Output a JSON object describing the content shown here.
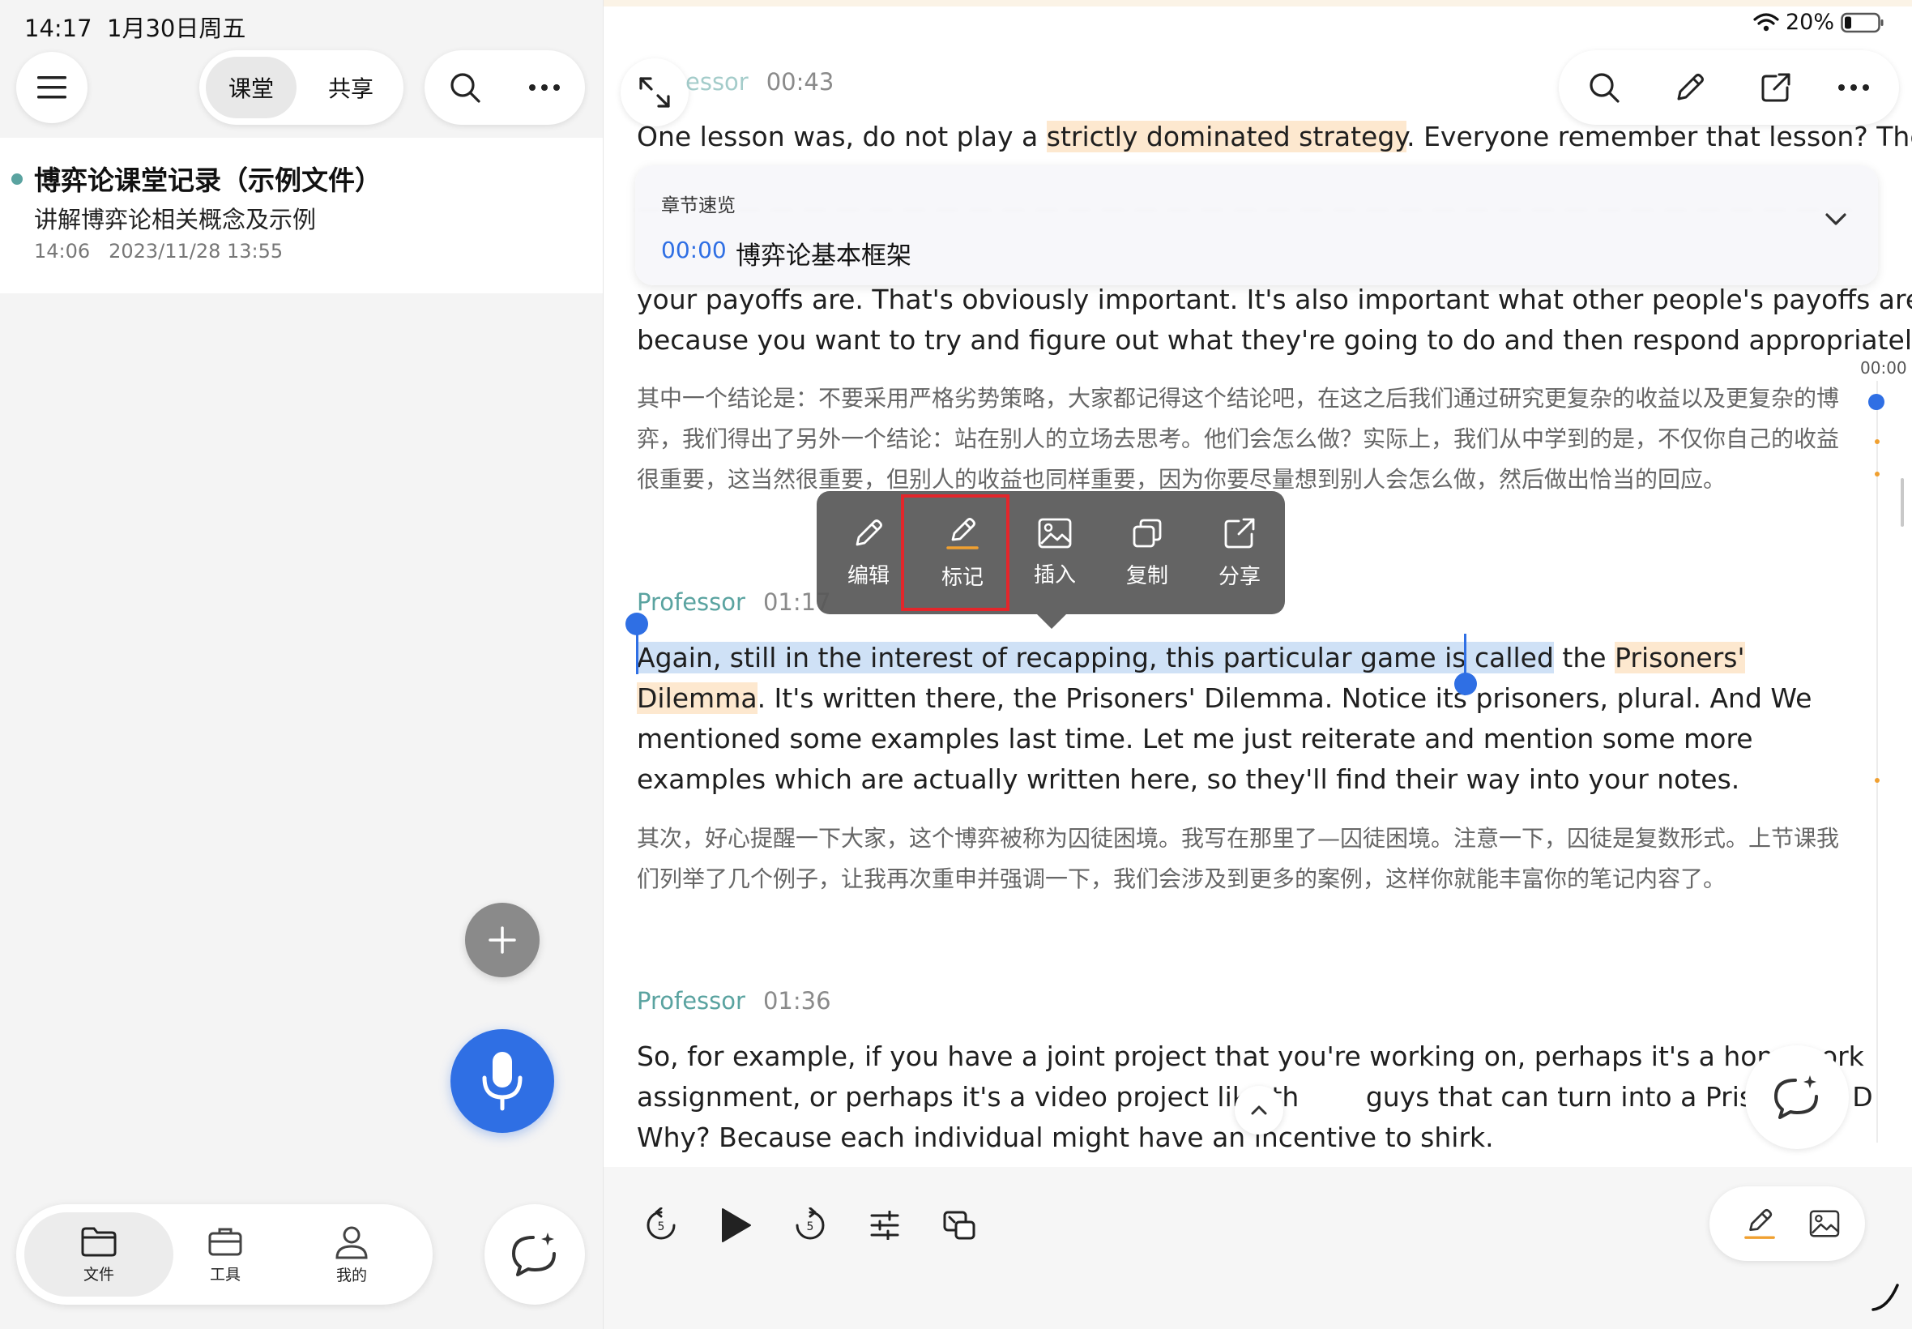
{
  "status": {
    "time": "14:17",
    "date": "1月30日周五",
    "battery": "20%"
  },
  "segment": {
    "class_label": "课堂",
    "share_label": "共享"
  },
  "file": {
    "title": "博弈论课堂记录（示例文件）",
    "description": "讲解博弈论相关概念及示例",
    "duration": "14:06",
    "datetime": "2023/11/28 13:55"
  },
  "tabs": {
    "files": "文件",
    "tools": "工具",
    "me": "我的"
  },
  "chapter": {
    "label": "章节速览",
    "time": "00:00",
    "title": "博弈论基本框架"
  },
  "transcript": {
    "seg1": {
      "speaker_partial": "essor",
      "time": "00:43",
      "en_line1_pre": "One lesson was, do not play a ",
      "en_line1_hl": "strictly dominated strategy",
      "en_line1_post": ". Everyone remember that lesson? Then",
      "en_line2": "your payoffs are. That's obviously important. It's also important what other people's payoffs are,",
      "en_line3": "because you want to try and figure out what they're going to do and then respond appropriately.",
      "zh": "其中一个结论是：不要采用严格劣势策略，大家都记得这个结论吧，在这之后我们通过研究更复杂的收益以及更复杂的博弈，我们得出了另外一个结论：站在别人的立场去思考。他们会怎么做？实际上，我们从中学到的是，不仅你自己的收益很重要，这当然很重要，但别人的收益也同样重要，因为你要尽量想到别人会怎么做，然后做出恰当的回应。"
    },
    "seg2": {
      "speaker": "Professor",
      "time": "01:17",
      "en_sel": "Again, still in the interest of recapping, this particular game is called",
      "en_mid": " the ",
      "en_hl": "Prisoners' Dilemma",
      "en_post": ". It's",
      "en_rest": "written there, the Prisoners' Dilemma. Notice its prisoners, plural. And We mentioned some examples last time. Let me just reiterate and mention some more examples which are actually written here, so they'll find their way into your notes.",
      "zh": "其次，好心提醒一下大家，这个博弈被称为囚徒困境。我写在那里了—囚徒困境。注意一下，囚徒是复数形式。上节课我们列举了几个例子，让我再次重申并强调一下，我们会涉及到更多的案例，这样你就能丰富你的笔记内容了。"
    },
    "seg3": {
      "speaker": "Professor",
      "time": "01:36",
      "en_line1": "So, for example, if you have a joint project that you're working on, perhaps it's a homework",
      "en_line2": "assignment, or perhaps it's a video project like th",
      "en_line2b": " guys that can turn into a Prisoners ' D",
      "en_line3": "Why? Because each individual might have an incentive to shirk."
    }
  },
  "context_menu": {
    "edit": "编辑",
    "mark": "标记",
    "insert": "插入",
    "copy": "复制",
    "share": "分享"
  },
  "timeline": {
    "time": "00:00"
  },
  "colors": {
    "accent": "#2f6fe4",
    "speaker": "#5aa3a0",
    "highlight": "#fde8cf",
    "selection": "#cfe1f6",
    "menu_bg": "#585858",
    "focus_box": "#e3262b"
  },
  "icons": {
    "menu": "hamburger-icon",
    "search": "search-icon",
    "more": "more-icon",
    "add": "plus-icon",
    "mic": "microphone-icon",
    "ai": "ai-chat-icon",
    "pen": "pen-icon",
    "export": "export-icon",
    "expand": "expand-icon"
  }
}
